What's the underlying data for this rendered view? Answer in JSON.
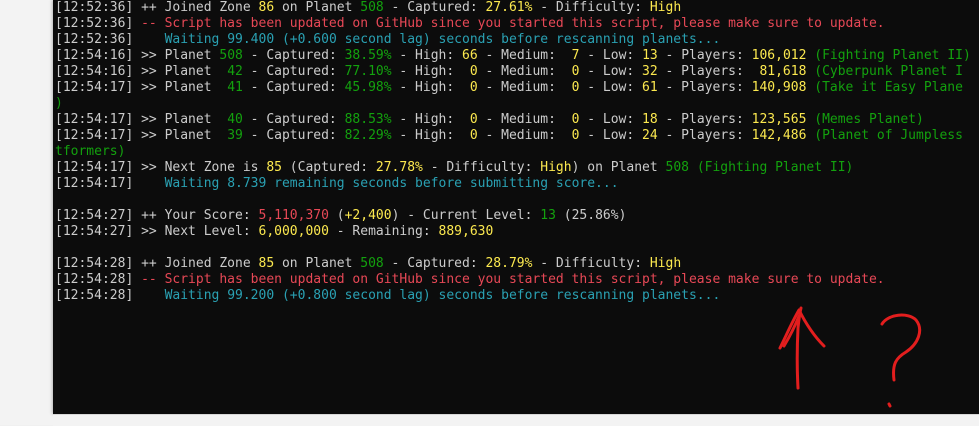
{
  "colors": {
    "background": "#0c0c0c",
    "text": "#cccccc",
    "green": "#16c60c",
    "yellow": "#fce94f",
    "red": "#e74856",
    "cyan": "#2aa1b3",
    "scribble": "#e31e1e"
  },
  "terminal": {
    "lines": [
      {
        "segments": [
          {
            "t": "[12:52:36] ++ Joined Zone ",
            "c": "white"
          },
          {
            "t": "86",
            "c": "yellow2"
          },
          {
            "t": " on Planet ",
            "c": "white"
          },
          {
            "t": "508",
            "c": "dkgreen"
          },
          {
            "t": " - Captured: ",
            "c": "white"
          },
          {
            "t": "27.61%",
            "c": "yellow2"
          },
          {
            "t": " - Difficulty: ",
            "c": "white"
          },
          {
            "t": "High",
            "c": "yellow2"
          }
        ]
      },
      {
        "segments": [
          {
            "t": "[12:52:36] ",
            "c": "white"
          },
          {
            "t": "-- Script has been updated on GitHub since you started this script, please make sure to update.",
            "c": "red"
          }
        ]
      },
      {
        "segments": [
          {
            "t": "[12:52:36]    ",
            "c": "white"
          },
          {
            "t": "Waiting 99.400 (+0.600 second lag) seconds before rescanning planets...",
            "c": "dkcyan"
          }
        ]
      },
      {
        "segments": [
          {
            "t": "[12:54:16] >> Planet ",
            "c": "white"
          },
          {
            "t": "508",
            "c": "dkgreen"
          },
          {
            "t": " - Captured: ",
            "c": "white"
          },
          {
            "t": "38.59%",
            "c": "dkgreen"
          },
          {
            "t": " - High: ",
            "c": "white"
          },
          {
            "t": "66",
            "c": "yellow2"
          },
          {
            "t": " - Medium: ",
            "c": "white"
          },
          {
            "t": " 7",
            "c": "yellow2"
          },
          {
            "t": " - Low: ",
            "c": "white"
          },
          {
            "t": "13",
            "c": "yellow2"
          },
          {
            "t": " - Players: ",
            "c": "white"
          },
          {
            "t": "106,012",
            "c": "yellow2"
          },
          {
            "t": " (Fighting Planet II)",
            "c": "dkgreen"
          }
        ]
      },
      {
        "segments": [
          {
            "t": "[12:54:16] >> Planet  ",
            "c": "white"
          },
          {
            "t": "42",
            "c": "dkgreen"
          },
          {
            "t": " - Captured: ",
            "c": "white"
          },
          {
            "t": "77.10%",
            "c": "dkgreen"
          },
          {
            "t": " - High: ",
            "c": "white"
          },
          {
            "t": " 0",
            "c": "yellow2"
          },
          {
            "t": " - Medium: ",
            "c": "white"
          },
          {
            "t": " 0",
            "c": "yellow2"
          },
          {
            "t": " - Low: ",
            "c": "white"
          },
          {
            "t": "32",
            "c": "yellow2"
          },
          {
            "t": " - Players: ",
            "c": "white"
          },
          {
            "t": " 81,618",
            "c": "yellow2"
          },
          {
            "t": " (Cyberpunk Planet I",
            "c": "dkgreen"
          }
        ]
      },
      {
        "segments": [
          {
            "t": "[12:54:17] >> Planet  ",
            "c": "white"
          },
          {
            "t": "41",
            "c": "dkgreen"
          },
          {
            "t": " - Captured: ",
            "c": "white"
          },
          {
            "t": "45.98%",
            "c": "dkgreen"
          },
          {
            "t": " - High: ",
            "c": "white"
          },
          {
            "t": " 0",
            "c": "yellow2"
          },
          {
            "t": " - Medium: ",
            "c": "white"
          },
          {
            "t": " 0",
            "c": "yellow2"
          },
          {
            "t": " - Low: ",
            "c": "white"
          },
          {
            "t": "61",
            "c": "yellow2"
          },
          {
            "t": " - Players: ",
            "c": "white"
          },
          {
            "t": "140,908",
            "c": "yellow2"
          },
          {
            "t": " (Take it Easy Plane",
            "c": "dkgreen"
          }
        ]
      },
      {
        "segments": [
          {
            "t": ")",
            "c": "dkgreen"
          }
        ]
      },
      {
        "segments": [
          {
            "t": "[12:54:17] >> Planet  ",
            "c": "white"
          },
          {
            "t": "40",
            "c": "dkgreen"
          },
          {
            "t": " - Captured: ",
            "c": "white"
          },
          {
            "t": "88.53%",
            "c": "dkgreen"
          },
          {
            "t": " - High: ",
            "c": "white"
          },
          {
            "t": " 0",
            "c": "yellow2"
          },
          {
            "t": " - Medium: ",
            "c": "white"
          },
          {
            "t": " 0",
            "c": "yellow2"
          },
          {
            "t": " - Low: ",
            "c": "white"
          },
          {
            "t": "18",
            "c": "yellow2"
          },
          {
            "t": " - Players: ",
            "c": "white"
          },
          {
            "t": "123,565",
            "c": "yellow2"
          },
          {
            "t": " (Memes Planet)",
            "c": "dkgreen"
          }
        ]
      },
      {
        "segments": [
          {
            "t": "[12:54:17] >> Planet  ",
            "c": "white"
          },
          {
            "t": "39",
            "c": "dkgreen"
          },
          {
            "t": " - Captured: ",
            "c": "white"
          },
          {
            "t": "82.29%",
            "c": "dkgreen"
          },
          {
            "t": " - High: ",
            "c": "white"
          },
          {
            "t": " 0",
            "c": "yellow2"
          },
          {
            "t": " - Medium: ",
            "c": "white"
          },
          {
            "t": " 0",
            "c": "yellow2"
          },
          {
            "t": " - Low: ",
            "c": "white"
          },
          {
            "t": "24",
            "c": "yellow2"
          },
          {
            "t": " - Players: ",
            "c": "white"
          },
          {
            "t": "142,486",
            "c": "yellow2"
          },
          {
            "t": " (Planet of Jumpless",
            "c": "dkgreen"
          }
        ]
      },
      {
        "segments": [
          {
            "t": "tformers)",
            "c": "dkgreen"
          }
        ]
      },
      {
        "segments": [
          {
            "t": "[12:54:17] >> Next Zone is ",
            "c": "white"
          },
          {
            "t": "85",
            "c": "yellow2"
          },
          {
            "t": " (Captured: ",
            "c": "white"
          },
          {
            "t": "27.78%",
            "c": "yellow2"
          },
          {
            "t": " - Difficulty: ",
            "c": "white"
          },
          {
            "t": "High",
            "c": "yellow2"
          },
          {
            "t": ") on Planet ",
            "c": "white"
          },
          {
            "t": "508",
            "c": "dkgreen"
          },
          {
            "t": " (Fighting Planet II)",
            "c": "dkgreen"
          }
        ]
      },
      {
        "segments": [
          {
            "t": "[12:54:17]    ",
            "c": "white"
          },
          {
            "t": "Waiting 8.739 remaining seconds before submitting score...",
            "c": "dkcyan"
          }
        ]
      },
      {
        "segments": []
      },
      {
        "segments": [
          {
            "t": "[12:54:27] ++ Your Score: ",
            "c": "white"
          },
          {
            "t": "5,110,370",
            "c": "red"
          },
          {
            "t": " (",
            "c": "white"
          },
          {
            "t": "+2,400",
            "c": "yellow2"
          },
          {
            "t": ") - Current Level: ",
            "c": "white"
          },
          {
            "t": "13",
            "c": "dkgreen"
          },
          {
            "t": " (25.86%)",
            "c": "white"
          }
        ]
      },
      {
        "segments": [
          {
            "t": "[12:54:27] >> Next Level: ",
            "c": "white"
          },
          {
            "t": "6,000,000",
            "c": "yellow2"
          },
          {
            "t": " - Remaining: ",
            "c": "white"
          },
          {
            "t": "889,630",
            "c": "yellow2"
          }
        ]
      },
      {
        "segments": []
      },
      {
        "segments": [
          {
            "t": "[12:54:28] ++ Joined Zone ",
            "c": "white"
          },
          {
            "t": "85",
            "c": "yellow2"
          },
          {
            "t": " on Planet ",
            "c": "white"
          },
          {
            "t": "508",
            "c": "dkgreen"
          },
          {
            "t": " - Captured: ",
            "c": "white"
          },
          {
            "t": "28.79%",
            "c": "yellow2"
          },
          {
            "t": " - Difficulty: ",
            "c": "white"
          },
          {
            "t": "High",
            "c": "yellow2"
          }
        ]
      },
      {
        "segments": [
          {
            "t": "[12:54:28] ",
            "c": "white"
          },
          {
            "t": "-- Script has been updated on GitHub since you started this script, please make sure to update.",
            "c": "red"
          }
        ]
      },
      {
        "segments": [
          {
            "t": "[12:54:28]    ",
            "c": "white"
          },
          {
            "t": "Waiting 99.200 (+0.800 second lag) seconds before rescanning planets...",
            "c": "dkcyan"
          }
        ]
      }
    ]
  },
  "annotation": {
    "arrow_icon": "hand-drawn-up-arrow-icon",
    "question_icon": "hand-drawn-question-mark-icon"
  }
}
